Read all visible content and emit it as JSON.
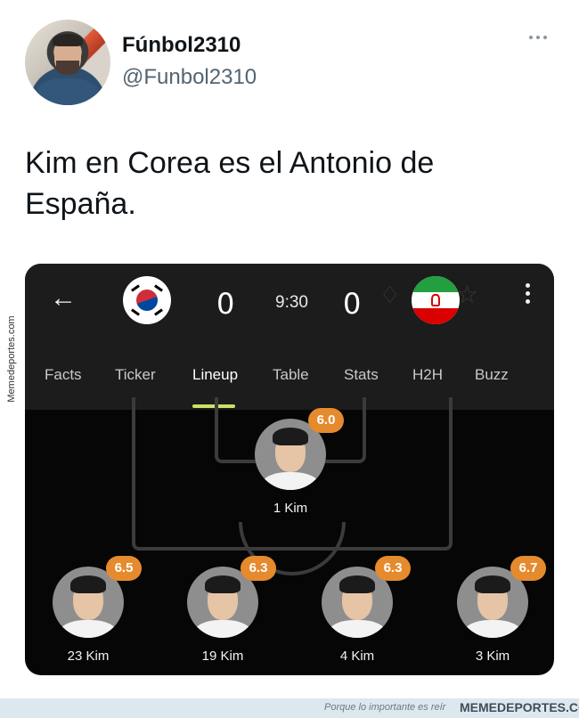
{
  "tweet": {
    "display_name": "Fúnbol2310",
    "handle": "@Funbol2310",
    "text": "Kim en Corea es el Antonio de España.",
    "more_icon": "ellipsis-icon"
  },
  "watermark_side": "Memedeportes.com",
  "app": {
    "back_icon": "arrow-left-icon",
    "home_team_flag": "south-korea-flag",
    "away_team_flag": "iran-flag",
    "home_score": "0",
    "away_score": "0",
    "match_time": "9:30",
    "tabs": [
      {
        "label": "Facts"
      },
      {
        "label": "Ticker"
      },
      {
        "label": "Lineup"
      },
      {
        "label": "Table"
      },
      {
        "label": "Stats"
      },
      {
        "label": "H2H"
      },
      {
        "label": "Buzz"
      }
    ],
    "active_tab": "Lineup",
    "accent_color": "#c9e265",
    "rating_color": "#e68a2e",
    "players": [
      {
        "name": "1 Kim",
        "rating": "6.0"
      },
      {
        "name": "23 Kim",
        "rating": "6.5"
      },
      {
        "name": "19 Kim",
        "rating": "6.3"
      },
      {
        "name": "4 Kim",
        "rating": "6.3"
      },
      {
        "name": "3 Kim",
        "rating": "6.7"
      }
    ]
  },
  "footer": {
    "slogan": "Porque lo importante es reír",
    "brand": "MEMEDEPORTES.COM"
  }
}
